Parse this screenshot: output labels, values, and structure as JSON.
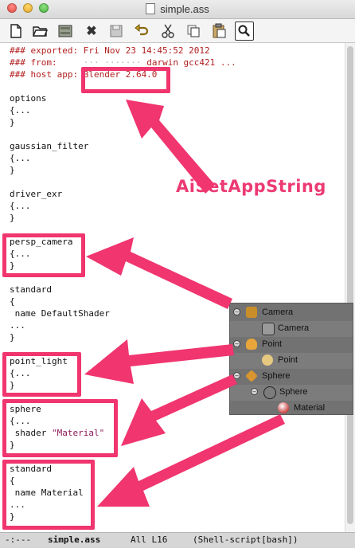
{
  "window": {
    "title": "simple.ass"
  },
  "toolbar": {
    "buttons": [
      "new-file-icon",
      "open-folder-icon",
      "save-drive-icon",
      "close-x-icon",
      "save-disk-icon",
      "undo-icon",
      "cut-scissors-icon",
      "copy-icon",
      "paste-clipboard-icon",
      "search-icon"
    ],
    "close_glyph": "✖"
  },
  "editor": {
    "lines": {
      "c1": "### exported: Fri Nov 23 14:45:52 2012",
      "c2a": "### from:",
      "c2b": "darwin gcc421 ...",
      "c3": "### host app: Blender 2.64.0",
      "options": "options",
      "options_open": "{...",
      "options_close": "}",
      "gauss": "gaussian_filter",
      "gauss_open": "{...",
      "gauss_close": "}",
      "driver": "driver_exr",
      "driver_open": "{...",
      "driver_close": "}",
      "persp": "persp_camera",
      "persp_open": "{...",
      "persp_close": "}",
      "std1": "standard",
      "std1_open": "{",
      "std1_name": " name DefaultShader",
      "std1_dots": "...",
      "std1_close": "}",
      "pl": "point_light",
      "pl_open": "{...",
      "pl_close": "}",
      "sph": "sphere",
      "sph_open": "{...",
      "sph_shader": " shader ",
      "sph_shader_val": "\"Material\"",
      "sph_close": "}",
      "std2": "standard",
      "std2_open": "{",
      "std2_name": " name Material",
      "std2_dots": "...",
      "std2_close": "}"
    }
  },
  "annotation": {
    "label": "AiSetAppString",
    "color": "#f0356f"
  },
  "outliner": {
    "rows": [
      {
        "label": "Camera",
        "icon": "camera-object-icon"
      },
      {
        "label": "Camera",
        "icon": "camera-data-icon"
      },
      {
        "label": "Point",
        "icon": "lamp-object-icon"
      },
      {
        "label": "Point",
        "icon": "lamp-data-icon"
      },
      {
        "label": "Sphere",
        "icon": "mesh-object-icon"
      },
      {
        "label": "Sphere",
        "icon": "mesh-data-icon"
      },
      {
        "label": "Material",
        "icon": "material-icon"
      }
    ]
  },
  "modeline": {
    "status": "-:---",
    "buffer": "simple.ass",
    "position": "All L16",
    "mode": "(Shell-script[bash])"
  }
}
